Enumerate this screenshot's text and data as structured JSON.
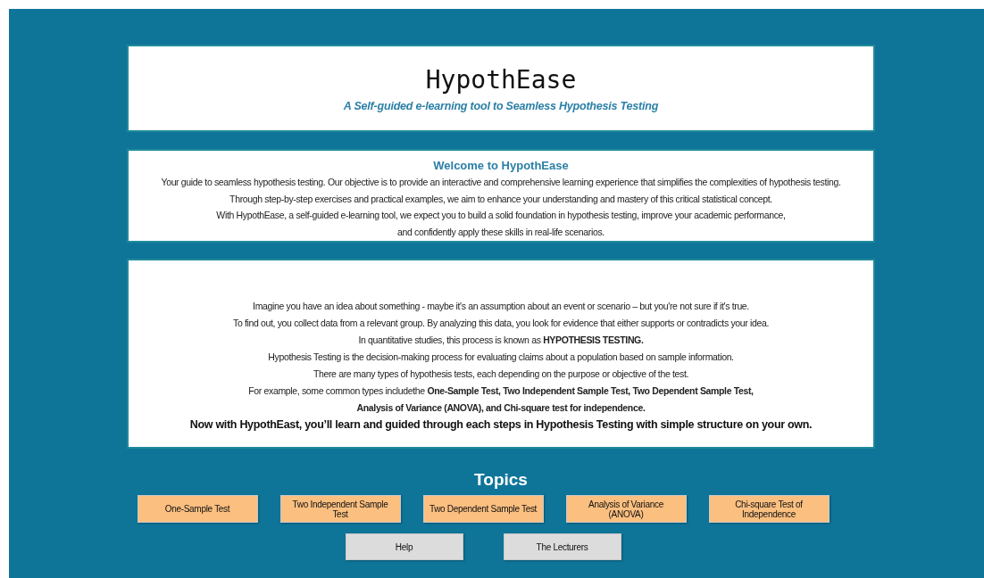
{
  "header": {
    "title": "HypothEase",
    "subtitle": "A Self-guided e-learning tool to Seamless Hypothesis Testing"
  },
  "welcome": {
    "heading": "Welcome to HypothEase",
    "lines": [
      "Your guide to seamless hypothesis testing. Our objective is to provide an interactive and comprehensive learning experience that simplifies the complexities of hypothesis testing.",
      "Through step-by-step exercises and practical examples, we aim to enhance your understanding and mastery of this critical statistical concept.",
      "With HypothEase, a self-guided e-learning tool, we expect you to build a solid foundation in hypothesis testing, improve your academic performance,",
      "and confidently apply these skills in real-life scenarios."
    ]
  },
  "intro": {
    "lines": [
      {
        "kind": "plain",
        "text": "Imagine you have an idea about something - maybe it's an assumption about an event or scenario – but you're not sure if it's true."
      },
      {
        "kind": "plain",
        "text": "To find out, you collect data from a relevant group. By analyzing this data, you look for evidence that either supports or contradicts your idea."
      },
      {
        "kind": "plain",
        "text": "In quantitative studies, this process is known as **HYPOTHESIS TESTING.**"
      },
      {
        "kind": "plain",
        "text": "Hypothesis Testing is the decision-making process for evaluating claims about a population based on sample information."
      },
      {
        "kind": "plain",
        "text": "There are many types of hypothesis tests, each depending on the purpose or objective of the test."
      },
      {
        "kind": "plain",
        "text": "For example, some common types includethe **One-Sample Test, Two Independent Sample Test, Two Dependent Sample Test,**"
      },
      {
        "kind": "plain",
        "text": "**Analysis of Variance (ANOVA), and Chi-square test for independence.**"
      },
      {
        "kind": "emphasis",
        "text": "Now with HypothEast, you’ll learn and guided through each steps in Hypothesis Testing with simple structure on your own."
      }
    ]
  },
  "topics": {
    "title": "Topics",
    "rows": [
      [
        {
          "label": "One-Sample Test",
          "kind": "topic"
        },
        {
          "label": "Two Independent Sample Test",
          "kind": "topic"
        },
        {
          "label": "Two Dependent Sample Test",
          "kind": "topic"
        },
        {
          "label": "Analysis of Variance (ANOVA)",
          "kind": "topic"
        },
        {
          "label": "Chi-square Test of Independence",
          "kind": "topic"
        }
      ],
      [
        {
          "label": "Help",
          "kind": "utility"
        },
        {
          "label": "The Lecturers",
          "kind": "utility"
        }
      ]
    ]
  }
}
